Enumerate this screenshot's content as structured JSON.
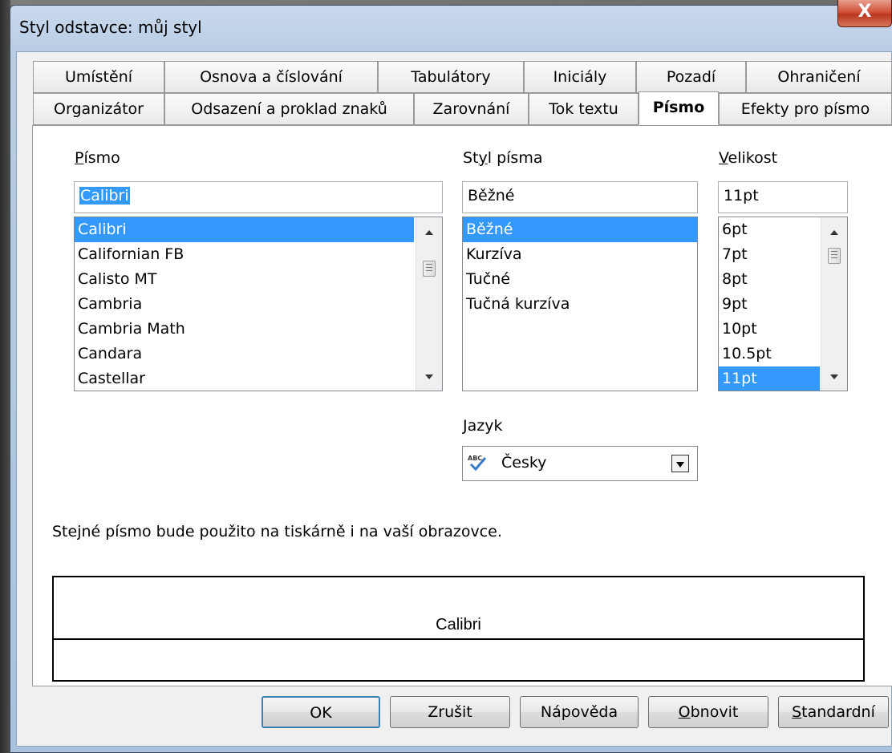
{
  "window": {
    "title": "Styl odstavce: můj styl",
    "close_label": "X"
  },
  "tabs_row1": [
    "Umístění",
    "Osnova a číslování",
    "Tabulátory",
    "Iniciály",
    "Pozadí",
    "Ohraničení"
  ],
  "tabs_row2": [
    "Organizátor",
    "Odsazení a proklad znaků",
    "Zarovnání",
    "Tok textu",
    "Písmo",
    "Efekty pro písmo"
  ],
  "selected_tab": "Písmo",
  "font": {
    "label_first": "P",
    "label_rest": "ísmo",
    "value": "Calibri",
    "options": [
      "Calibri",
      "Californian FB",
      "Calisto MT",
      "Cambria",
      "Cambria Math",
      "Candara",
      "Castellar"
    ],
    "selected": "Calibri"
  },
  "style": {
    "label_pre": "St",
    "label_u": "y",
    "label_post": "l písma",
    "value": "Běžné",
    "options": [
      "Běžné",
      "Kurzíva",
      "Tučné",
      "Tučná kurzíva"
    ],
    "selected": "Běžné"
  },
  "size": {
    "label_first": "V",
    "label_rest": "elikost",
    "value": "11pt",
    "options": [
      "6pt",
      "7pt",
      "8pt",
      "9pt",
      "10pt",
      "10.5pt",
      "11pt"
    ],
    "selected": "11pt"
  },
  "language": {
    "label_first": "J",
    "label_rest": "azyk",
    "icon": "spellcheck-abc-icon",
    "value": "Česky"
  },
  "info_text": "Stejné písmo bude použito na tiskárně i na vaší obrazovce.",
  "preview_text": "Calibri",
  "buttons": {
    "ok": "OK",
    "cancel": "Zrušit",
    "help": "Nápověda",
    "reset_first": "O",
    "reset_rest": "bnovit",
    "standard_first": "S",
    "standard_rest": "tandardní"
  },
  "colors": {
    "selection": "#3399ff",
    "title_bg": "#b8cde4",
    "close_bg": "#c8432b"
  }
}
